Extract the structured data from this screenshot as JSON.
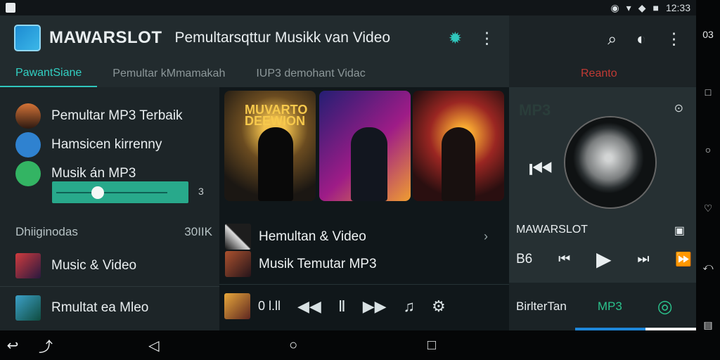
{
  "status": {
    "time": "12:33",
    "battery": "■",
    "signal": "◆"
  },
  "header": {
    "brand": "MAWARSLOT",
    "subtitle": "Pemultarsqttur Musikk van Video"
  },
  "tabs": [
    {
      "label": "PawantSiane"
    },
    {
      "label": "Pemultar kMmamakah"
    },
    {
      "label": "IUP3 demohant Vidac"
    }
  ],
  "side": {
    "items": [
      {
        "label": "Pemultar MP3 Terbaik"
      },
      {
        "label": "Hamsicen kirrenny"
      },
      {
        "label": "Musik án MP3"
      }
    ],
    "count": "3",
    "heading": "Dhiiginodas",
    "heading_value": "30IIK",
    "rows": [
      {
        "label": "Music & Video"
      },
      {
        "label": "Rmultat ea Mleo"
      }
    ]
  },
  "cards": [
    {
      "title": "MUVARTO DEEWION"
    },
    {
      "title": ""
    },
    {
      "title": ""
    }
  ],
  "content": {
    "rows": [
      {
        "label": "Hemultan & Video"
      },
      {
        "label": "Musik Temutar MP3"
      }
    ],
    "player_time": "0 l.ll"
  },
  "right": {
    "top_label": "Reanto",
    "now_label": "MP3",
    "brand": "MAWARSLOT",
    "left_value": "B6",
    "footer_left": "BirlterTan",
    "footer_mid": "MP3"
  },
  "colors": {
    "accent": "#2fc6bd",
    "panel": "#263033",
    "bg": "#0b0f12"
  }
}
